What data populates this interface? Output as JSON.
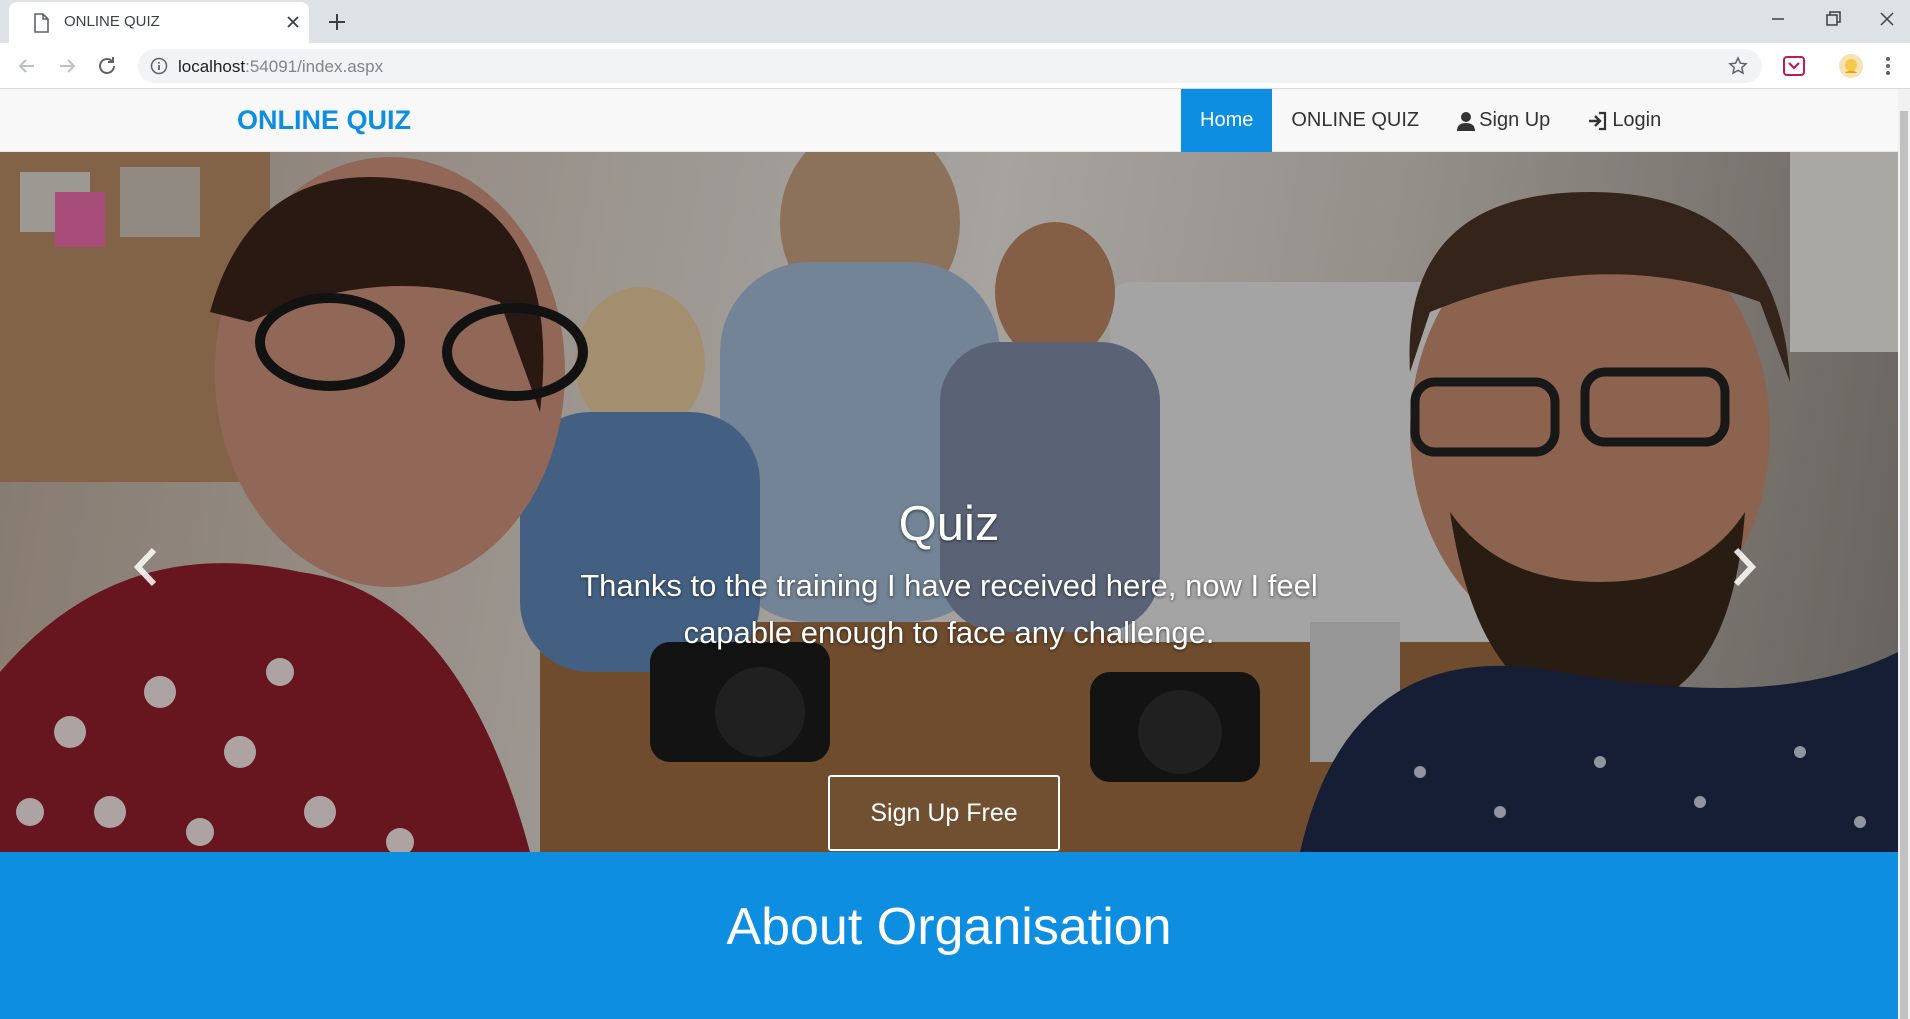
{
  "browser": {
    "tab_title": "ONLINE QUIZ",
    "url_host": "localhost",
    "url_rest": ":54091/index.aspx"
  },
  "site": {
    "brand": "ONLINE QUIZ",
    "accent_color": "#0d8ee0",
    "menu": [
      {
        "label": "Home",
        "active": true,
        "icon": ""
      },
      {
        "label": "ONLINE QUIZ",
        "active": false,
        "icon": ""
      },
      {
        "label": "Sign Up",
        "active": false,
        "icon": "user-icon"
      },
      {
        "label": "Login",
        "active": false,
        "icon": "login-icon"
      }
    ]
  },
  "hero": {
    "title": "Quiz",
    "text": "Thanks to the training I have received here, now I feel capable enough to face any challenge.",
    "cta": "Sign Up Free",
    "slide_count": 4,
    "active_slide": 1
  },
  "about": {
    "title": "About Organisation"
  }
}
